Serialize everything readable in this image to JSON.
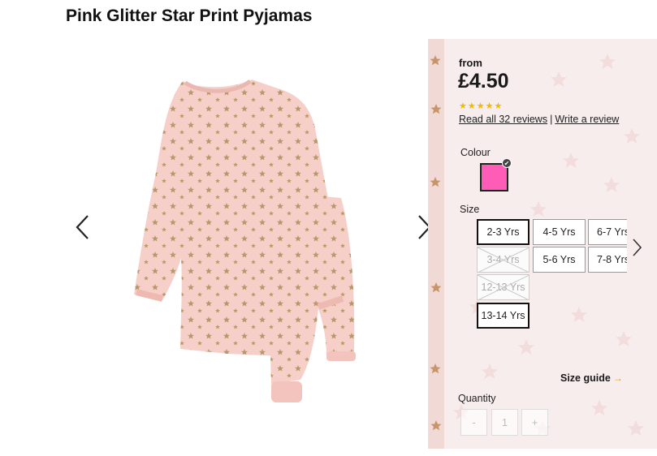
{
  "product": {
    "title": "Pink Glitter Star Print Pyjamas",
    "image_alt": "pink-glitter-star-print-pyjamas",
    "colors": {
      "pyjama": "#f6cfc9",
      "star": "#b89868",
      "swatch": "#ff5cb8",
      "rating": "#f1b900"
    }
  },
  "price": {
    "from_label": "from",
    "amount": "£4.50"
  },
  "rating": {
    "stars": "★★★★★",
    "value": 4.5,
    "out_of": 5,
    "read_reviews": "Read all 32 reviews",
    "separator": "|",
    "write_review": "Write a review"
  },
  "colour": {
    "label": "Colour",
    "selected_hex": "#ff5cb8",
    "check_icon": "✔"
  },
  "size": {
    "label": "Size",
    "options": [
      {
        "label": "2-3 Yrs",
        "state": "selected"
      },
      {
        "label": "4-5 Yrs",
        "state": "available"
      },
      {
        "label": "6-7 Yrs",
        "state": "available"
      },
      {
        "label": "3-4 Yrs",
        "state": "unavailable"
      },
      {
        "label": "5-6 Yrs",
        "state": "available"
      },
      {
        "label": "7-8 Yrs",
        "state": "available"
      },
      {
        "label": "12-13 Yrs",
        "state": "unavailable"
      },
      {
        "label": "13-14 Yrs",
        "state": "available"
      }
    ],
    "guide": "Size guide",
    "guide_arrow": "→"
  },
  "quantity": {
    "label": "Quantity",
    "minus": "-",
    "value": "1",
    "plus": "+"
  },
  "icons": {
    "prev": "chevron-left-icon",
    "next": "chevron-right-icon",
    "size_next": "chevron-right-icon"
  }
}
